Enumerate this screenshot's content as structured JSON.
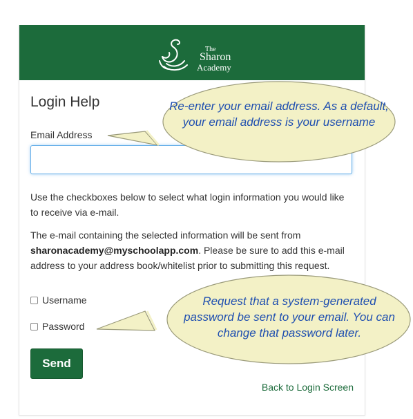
{
  "header": {
    "logo_line1": "The",
    "logo_line2": "Sharon",
    "logo_line3": "Academy"
  },
  "title": "Login Help",
  "email": {
    "label": "Email Address",
    "value": "",
    "placeholder": ""
  },
  "instructions": "Use the checkboxes below to select what login information you would like to receive via e-mail.",
  "notice": {
    "prefix": "The e-mail containing the selected information will be sent from",
    "address": "sharonacademy@myschoolapp.com",
    "suffix": ". Please be sure to add this e-mail address to your address book/whitelist prior to submitting this request."
  },
  "options": [
    {
      "label": "Username",
      "checked": false
    },
    {
      "label": "Password",
      "checked": false
    }
  ],
  "send_label": "Send",
  "back_link": "Back to Login Screen",
  "callouts": {
    "email": "Re-enter your email address.  As a default, your email address is your username",
    "password": "Request that a system-generated password be sent to your email. You can change that password later."
  },
  "colors": {
    "brand_green": "#1c6b3b",
    "callout_fill": "#f3f1c6",
    "callout_text": "#1f4fb0"
  }
}
